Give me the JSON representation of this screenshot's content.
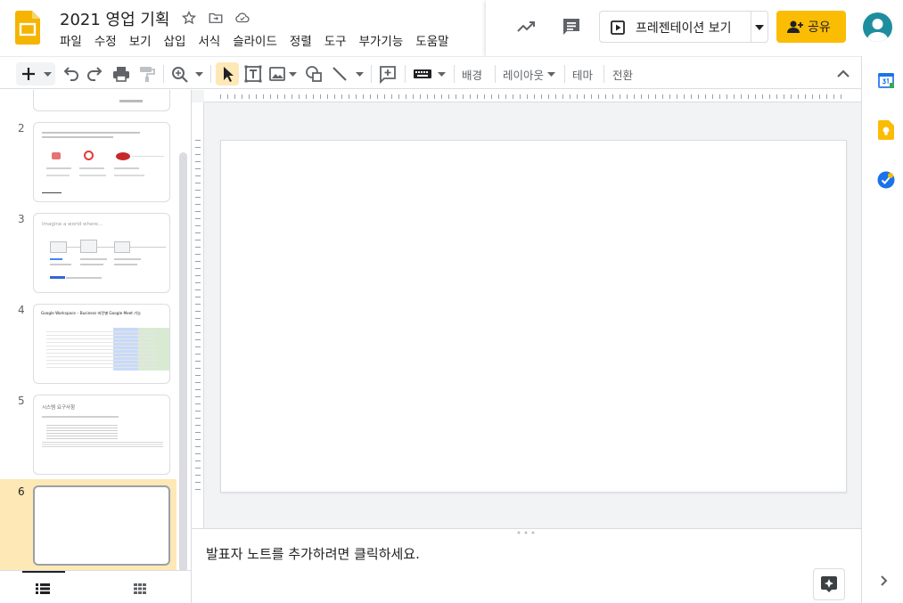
{
  "doc": {
    "title": "2021 영업 기획"
  },
  "menu": [
    "파일",
    "수정",
    "보기",
    "삽입",
    "서식",
    "슬라이드",
    "정렬",
    "도구",
    "부가기능",
    "도움말"
  ],
  "header": {
    "present_label": "프레젠테이션 보기",
    "share_label": "공유"
  },
  "toolbar": {
    "background": "배경",
    "layout": "레이아웃",
    "theme": "테마",
    "transition": "전환"
  },
  "filmstrip": {
    "slides": [
      {
        "number": "2"
      },
      {
        "number": "3",
        "heading": "Imagine a world where..."
      },
      {
        "number": "4",
        "heading": "Google Workspace – Business 버전별 Google Meet 기능"
      },
      {
        "number": "5",
        "heading": "시스템 요구사항"
      },
      {
        "number": "6"
      }
    ],
    "selected": "6"
  },
  "notes": {
    "placeholder": "발표자 노트를 추가하려면 클릭하세요."
  },
  "colors": {
    "accent": "#fbbc04",
    "selected_slide": "#fde8b6",
    "logo": "#f4b400"
  }
}
